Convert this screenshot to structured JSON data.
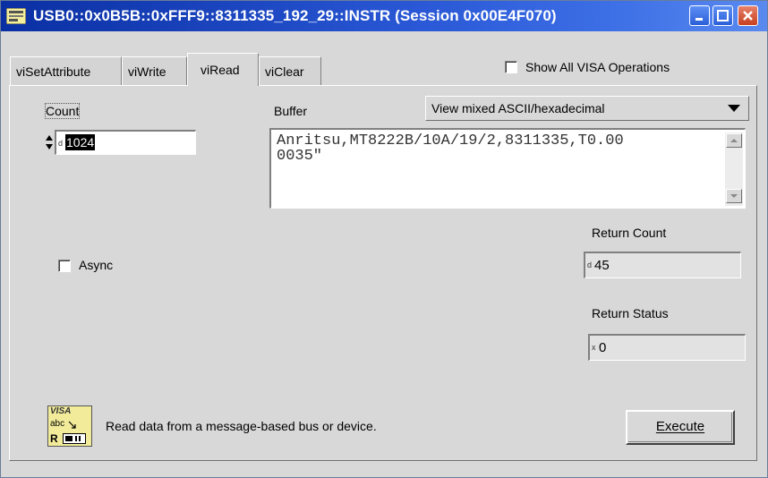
{
  "window": {
    "title": "USB0::0x0B5B::0xFFF9::8311335_192_29::INSTR (Session 0x00E4F070)"
  },
  "tabs": [
    {
      "label": "viSetAttribute",
      "active": false
    },
    {
      "label": "viWrite",
      "active": false
    },
    {
      "label": "viRead",
      "active": true
    },
    {
      "label": "viClear",
      "active": false
    }
  ],
  "show_all_visa": {
    "label": "Show All VISA Operations",
    "checked": false
  },
  "count": {
    "label": "Count",
    "radix": "d",
    "value": "1024"
  },
  "buffer": {
    "label": "Buffer",
    "view_mode": "View mixed ASCII/hexadecimal",
    "content": "Anritsu,MT8222B/10A/19/2,8311335,T0.00\n0035\""
  },
  "async": {
    "label": "Async",
    "checked": false
  },
  "return_count": {
    "label": "Return Count",
    "radix": "d",
    "value": "45"
  },
  "return_status": {
    "label": "Return Status",
    "radix": "x",
    "value": "0"
  },
  "description": "Read data from a message-based bus or device.",
  "execute": {
    "label": "Execute"
  },
  "visa_icon": {
    "line1": "VISA",
    "line2": "abc",
    "line3": "R"
  },
  "colors": {
    "titlebar_start": "#0a2fa3",
    "titlebar_end": "#5a8aef",
    "background": "#d8d8d8"
  }
}
